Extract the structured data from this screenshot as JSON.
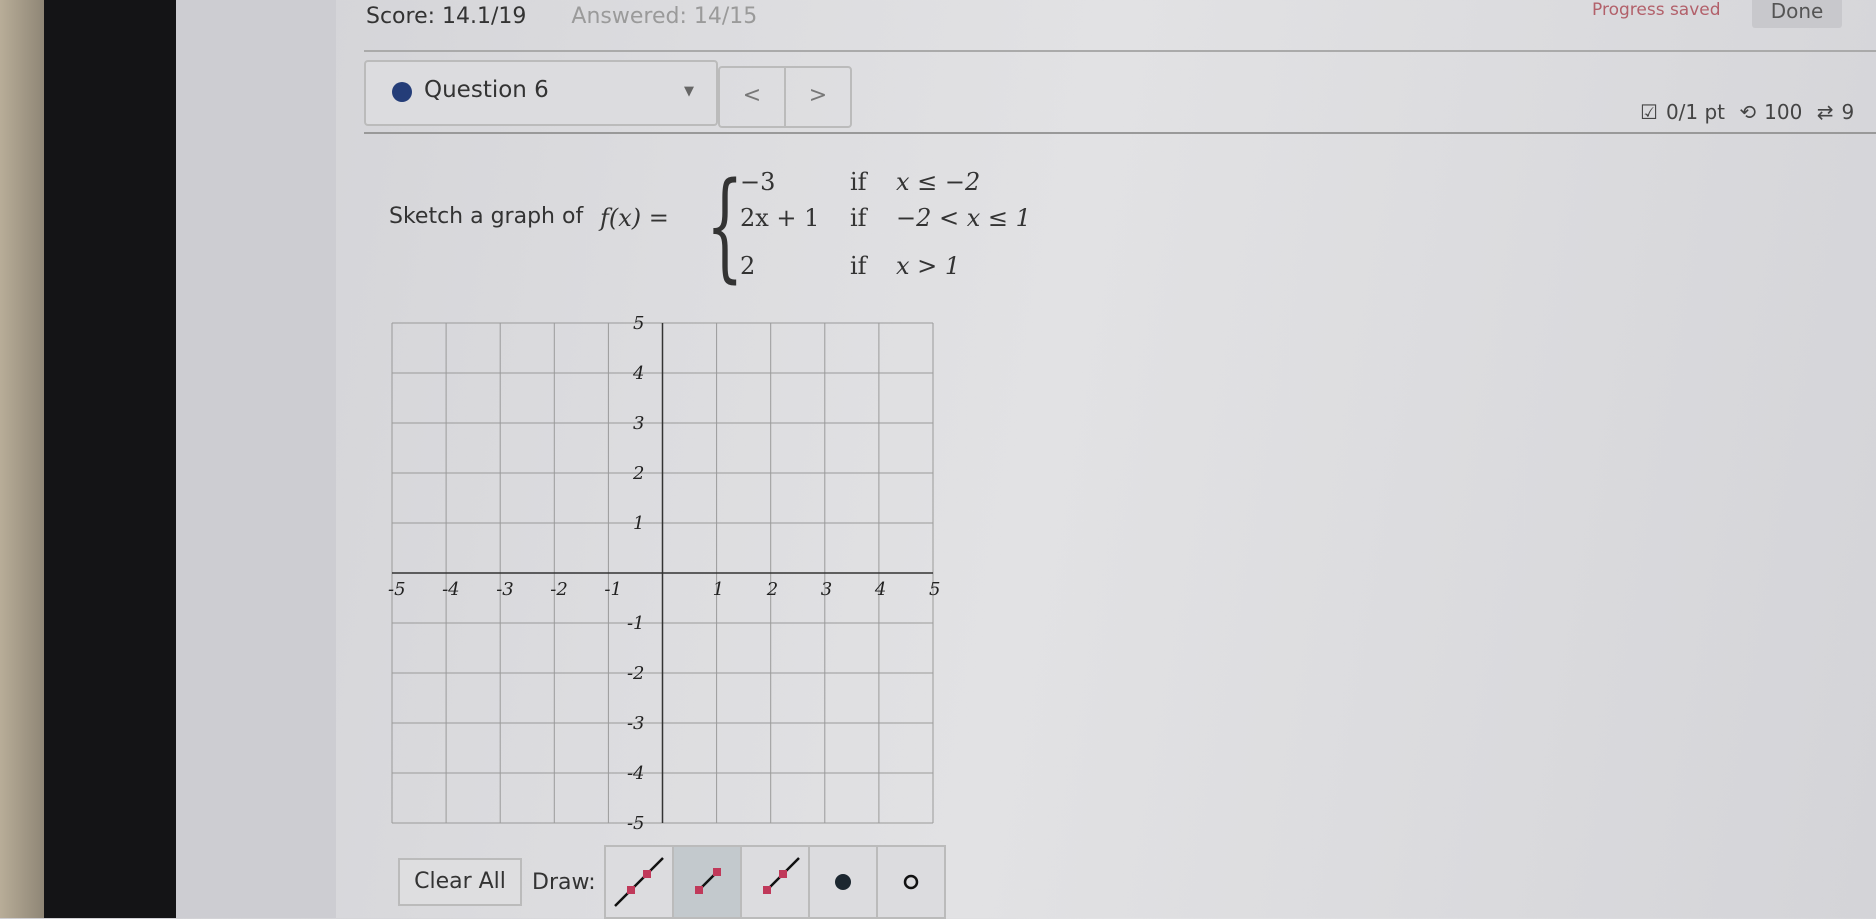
{
  "header": {
    "score": "Score: 14.1/19",
    "answered": "Answered: 14/15",
    "progress": "Progress saved",
    "done_label": "Done"
  },
  "question": {
    "label": "Question 6",
    "prev": "<",
    "next": ">",
    "points": "0/1 pt",
    "retries": "100",
    "attempts": "9",
    "status_color": "#243d78"
  },
  "prompt": {
    "text": "Sketch a graph of",
    "lhs": "f(x) =",
    "pieces": [
      {
        "expr": "−3",
        "cond_word": "if",
        "cond": "x ≤ −2"
      },
      {
        "expr": "2x + 1",
        "cond_word": "if",
        "cond": "−2 < x ≤ 1"
      },
      {
        "expr": "2",
        "cond_word": "if",
        "cond": "x > 1"
      }
    ]
  },
  "graph": {
    "xlim": [
      -5,
      5
    ],
    "ylim": [
      -5,
      5
    ],
    "grid": true,
    "xticks": [
      "-5",
      "-4",
      "-3",
      "-2",
      "-1",
      "1",
      "2",
      "3",
      "4",
      "5"
    ],
    "yticks": [
      "5",
      "4",
      "3",
      "2",
      "1",
      "-1",
      "-2",
      "-3",
      "-4",
      "-5"
    ]
  },
  "toolbar": {
    "clear_label": "Clear All",
    "draw_label": "Draw:",
    "tools": [
      {
        "icon": "line-icon",
        "active": false
      },
      {
        "icon": "segment-icon",
        "active": true
      },
      {
        "icon": "ray-icon",
        "active": false
      },
      {
        "icon": "closed-dot-icon",
        "active": false
      },
      {
        "icon": "open-dot-icon",
        "active": false
      }
    ],
    "point_color": "#c0395a"
  }
}
